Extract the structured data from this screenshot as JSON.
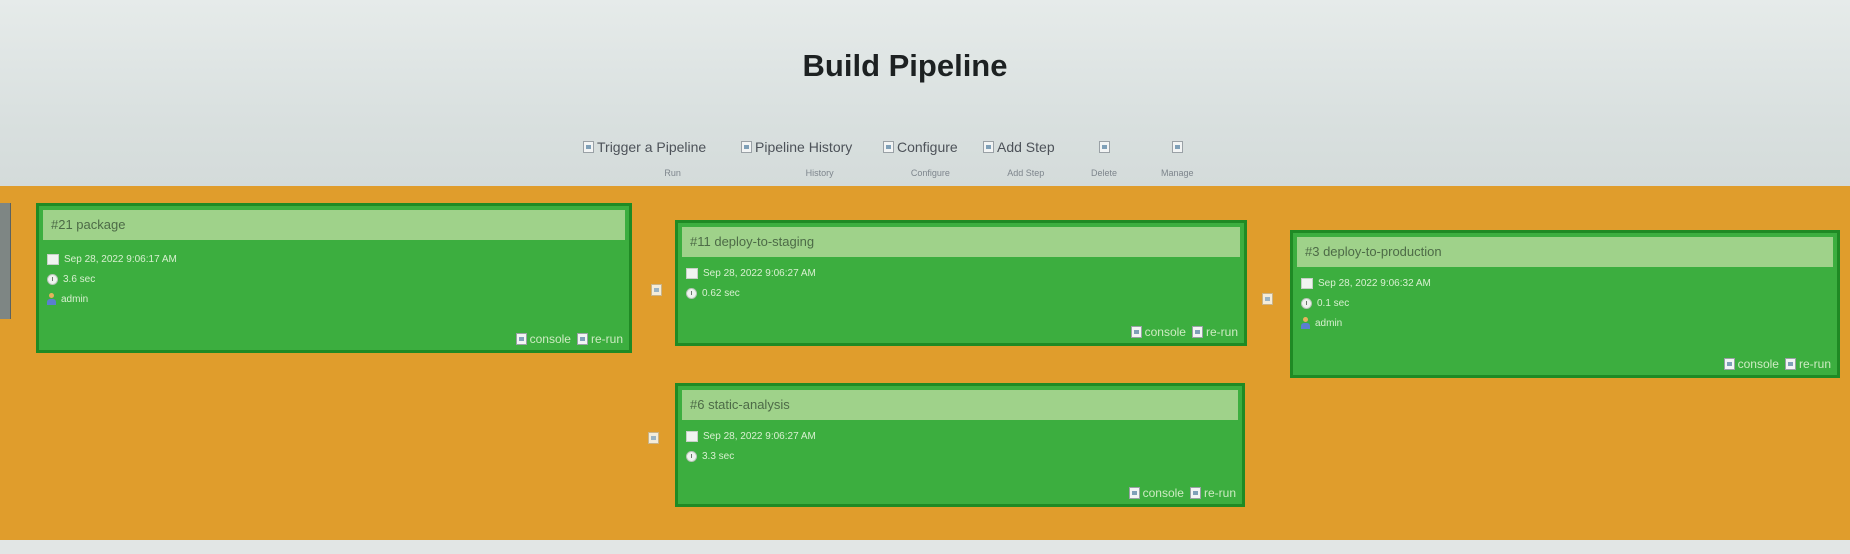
{
  "page": {
    "title": "Build Pipeline"
  },
  "toolbar": {
    "items": [
      {
        "id": "trigger",
        "label": "Trigger a Pipeline",
        "sub": "Run"
      },
      {
        "id": "history",
        "label": "Pipeline History",
        "sub": "History"
      },
      {
        "id": "configure",
        "label": "Configure",
        "sub": "Configure"
      },
      {
        "id": "add-step",
        "label": "Add Step",
        "sub": "Add Step"
      },
      {
        "id": "delete",
        "label": "",
        "sub": "Delete"
      },
      {
        "id": "manage",
        "label": "",
        "sub": "Manage"
      }
    ]
  },
  "cards": [
    {
      "id": "package",
      "title": "#21 package",
      "date": "Sep 28, 2022 9:06:17 AM",
      "duration": "3.6 sec",
      "user": "admin",
      "console": "console",
      "rerun": "re-run"
    },
    {
      "id": "deploy-to-staging",
      "title": "#11 deploy-to-staging",
      "date": "Sep 28, 2022 9:06:27 AM",
      "duration": "0.62 sec",
      "console": "console",
      "rerun": "re-run"
    },
    {
      "id": "deploy-to-production",
      "title": "#3 deploy-to-production",
      "date": "Sep 28, 2022 9:06:32 AM",
      "duration": "0.1 sec",
      "user": "admin",
      "console": "console",
      "rerun": "re-run"
    },
    {
      "id": "static-analysis",
      "title": "#6 static-analysis",
      "date": "Sep 28, 2022 9:06:27 AM",
      "duration": "3.3 sec",
      "console": "console",
      "rerun": "re-run"
    }
  ],
  "colors": {
    "background_orange": "#e09d2c",
    "card_green": "#3cae3f",
    "card_border": "#1f8a24",
    "card_header": "#9fd28a"
  }
}
